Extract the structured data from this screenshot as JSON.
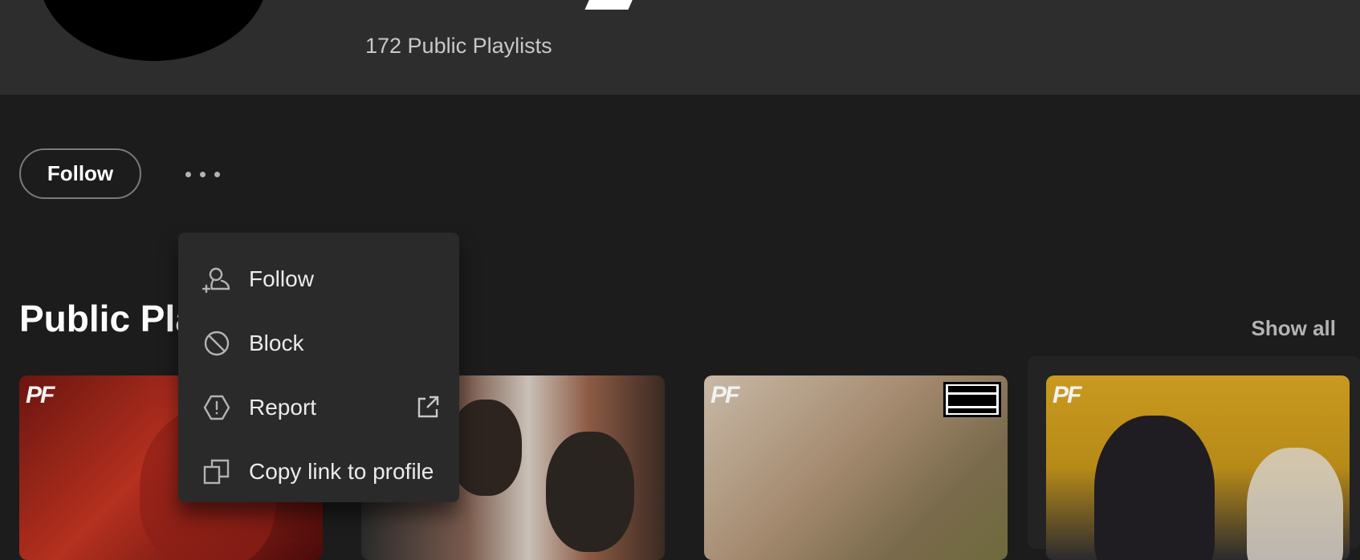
{
  "header": {
    "playlist_count": "172 Public Playlists"
  },
  "actions": {
    "follow_label": "Follow",
    "more_icon": "more-options-icon"
  },
  "section": {
    "title": "Public Playlists",
    "show_all": "Show all"
  },
  "context_menu": {
    "items": [
      {
        "label": "Follow",
        "icon": "add-user-icon"
      },
      {
        "label": "Block",
        "icon": "block-icon"
      },
      {
        "label": "Report",
        "icon": "report-icon",
        "trailing_icon": "external-link-icon"
      },
      {
        "label": "Copy link to profile",
        "icon": "copy-icon"
      }
    ]
  },
  "playlists": [
    {
      "logo": "PF"
    },
    {
      "logo": ""
    },
    {
      "logo": "PF",
      "badge": "PARENTAL ADVISORY EXPLICIT CONTENT"
    },
    {
      "logo": "PF"
    }
  ],
  "colors": {
    "background": "#1c1c1c",
    "header": "#2d2d2d",
    "menu": "#2a2a2a",
    "text_muted": "#b3b3b3"
  }
}
